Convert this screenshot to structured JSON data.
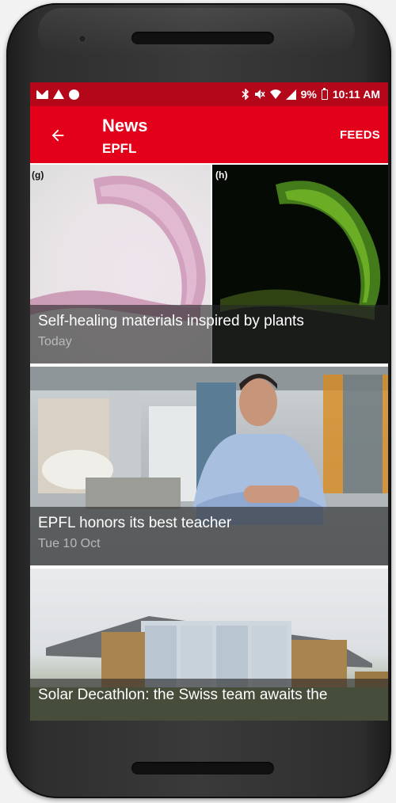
{
  "statusbar": {
    "left_icons": [
      "mail-icon",
      "warning-icon",
      "compass-icon"
    ],
    "right_icons": [
      "bluetooth-icon",
      "mute-icon",
      "wifi-icon",
      "signal-icon",
      "battery-icon"
    ],
    "battery": "9%",
    "time": "10:11 AM"
  },
  "appbar": {
    "title": "News",
    "subtitle": "EPFL",
    "back_icon": "arrow-left-icon",
    "action_label": "FEEDS"
  },
  "colors": {
    "statusbar": "#b5071a",
    "appbar": "#e2001a"
  },
  "feed": {
    "items": [
      {
        "title": "Self-healing materials inspired by plants",
        "date": "Today",
        "image_labels": [
          "(g)",
          "(h)"
        ]
      },
      {
        "title": "EPFL honors its best teacher",
        "date": "Tue 10 Oct"
      },
      {
        "title": "Solar Decathlon: the Swiss team awaits the",
        "date": ""
      }
    ]
  }
}
